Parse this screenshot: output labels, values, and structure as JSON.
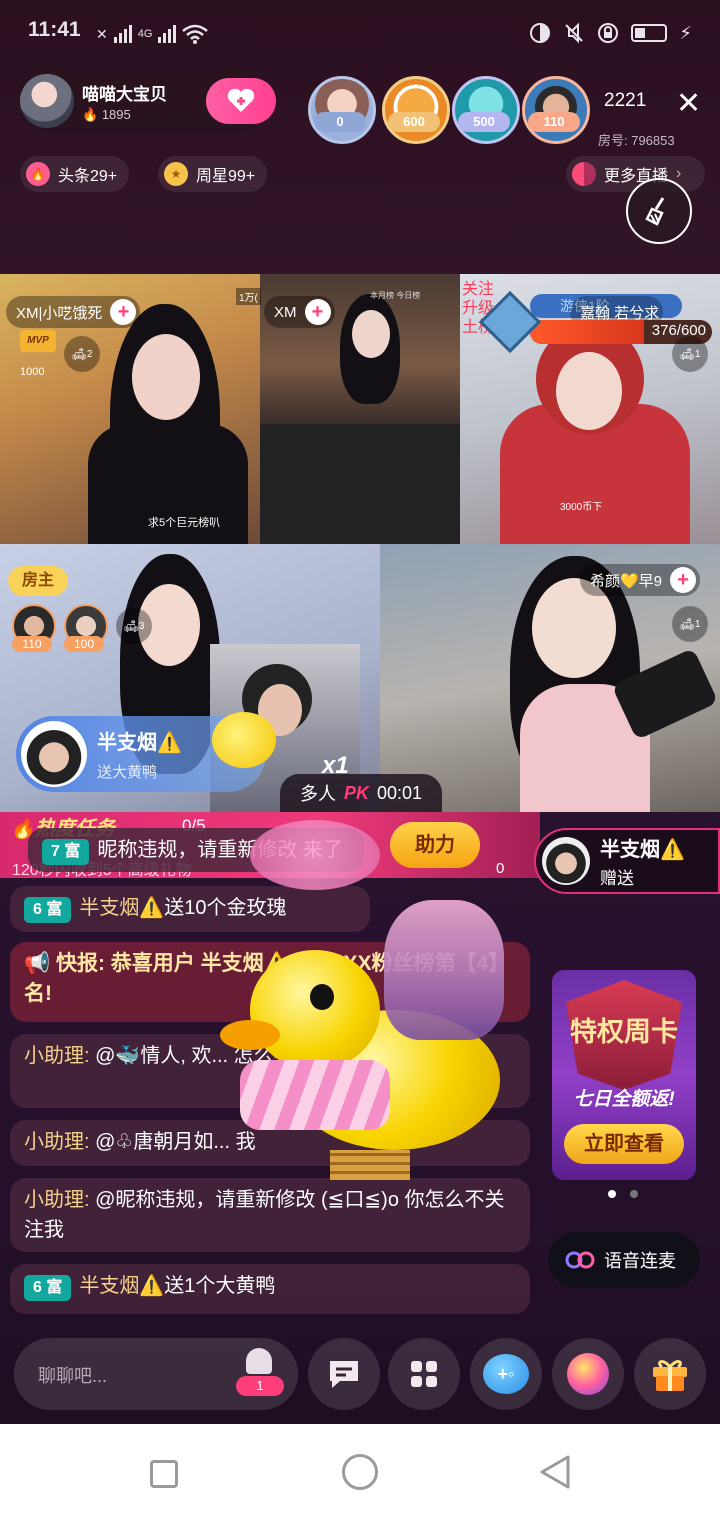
{
  "status_bar": {
    "time": "11:41",
    "network": "4G",
    "icons": [
      "sim-icon",
      "signal-icon",
      "wifi-icon",
      "moon-icon",
      "mute-icon",
      "lock-icon",
      "battery-icon",
      "charging-icon"
    ]
  },
  "host": {
    "name": "喵喵大宝贝",
    "fans": "1895"
  },
  "viewers": [
    {
      "badge": "0",
      "color": "#8fa6d6"
    },
    {
      "badge": "600",
      "color": "#f1c276"
    },
    {
      "badge": "500",
      "color": "#b3b6f0"
    },
    {
      "badge": "110",
      "color": "#f6a889"
    }
  ],
  "viewer_count": "2221",
  "room_id": "房号: 796853",
  "ranks": {
    "headline": "头条29+",
    "weekly_star": "周星99+"
  },
  "more_live": "更多直播",
  "grid": {
    "c1": {
      "name": "XM|小呓饿死",
      "seat": "2",
      "mvp": "MVP",
      "score": "1000",
      "caption": "求5个巨元榜叭"
    },
    "c2": {
      "name": "XM",
      "top": "1万(",
      "top2": "本月榜",
      "top3": "今日榜"
    },
    "c3": {
      "name": "嘉翰 若兮求",
      "level": "游侠1阶",
      "progress": "376/600",
      "progress_value": 0.627,
      "seat": "1",
      "side_text": "关注 升级 土榜",
      "gift_label": "3000币下"
    },
    "c4": {
      "owner_label": "房主",
      "seat": "3",
      "guest1": "110",
      "guest2": "100"
    },
    "c5": {
      "name": "希颜💛早9",
      "seat": "1"
    },
    "pk": {
      "label": "多人",
      "pk_text": "PK",
      "time": "00:01",
      "multiplier": "x1"
    }
  },
  "gift_popup": {
    "user": "半支烟⚠️",
    "action": "送大黄鸭"
  },
  "task_bar": {
    "title": "热度任务",
    "progress": "0/5",
    "desc": "120秒内收到5个高级礼物",
    "assist": "助力",
    "count": "0"
  },
  "gift_banner": {
    "user": "半支烟⚠️",
    "action": "赠送"
  },
  "chat": [
    {
      "level": "7 富",
      "user": "",
      "text": "昵称违规，请重新修改 来了"
    },
    {
      "level": "6 富",
      "user": "半支烟⚠️",
      "text": "送10个金玫瑰"
    },
    {
      "level": "",
      "user": "",
      "text": "📢 快报: 恭喜用户 半支烟⚠️ 成功 XX粉丝榜第【4】名!"
    },
    {
      "level": "",
      "user": "小助理: ",
      "text": "@🐳情人, 欢... 怎么不关注我"
    },
    {
      "level": "",
      "user": "小助理: ",
      "text": "@♧唐朝月如... 我"
    },
    {
      "level": "",
      "user": "小助理: ",
      "text": "@昵称违规，请重新修改 (≦口≦)o 你怎么不关注我"
    },
    {
      "level": "6 富",
      "user": "半支烟⚠️",
      "text": "送1个大黄鸭"
    }
  ],
  "promo": {
    "title": "特权周卡",
    "subtitle": "七日全额返!",
    "button": "立即查看"
  },
  "voice_link": "语音连麦",
  "input_placeholder": "聊聊吧...",
  "bottom_badge": "1",
  "colors": {
    "accent": "#ff4a8d",
    "chat_bg": "#5a3246",
    "level_badge": "#13a89e",
    "name_gold": "#f6d38a"
  }
}
